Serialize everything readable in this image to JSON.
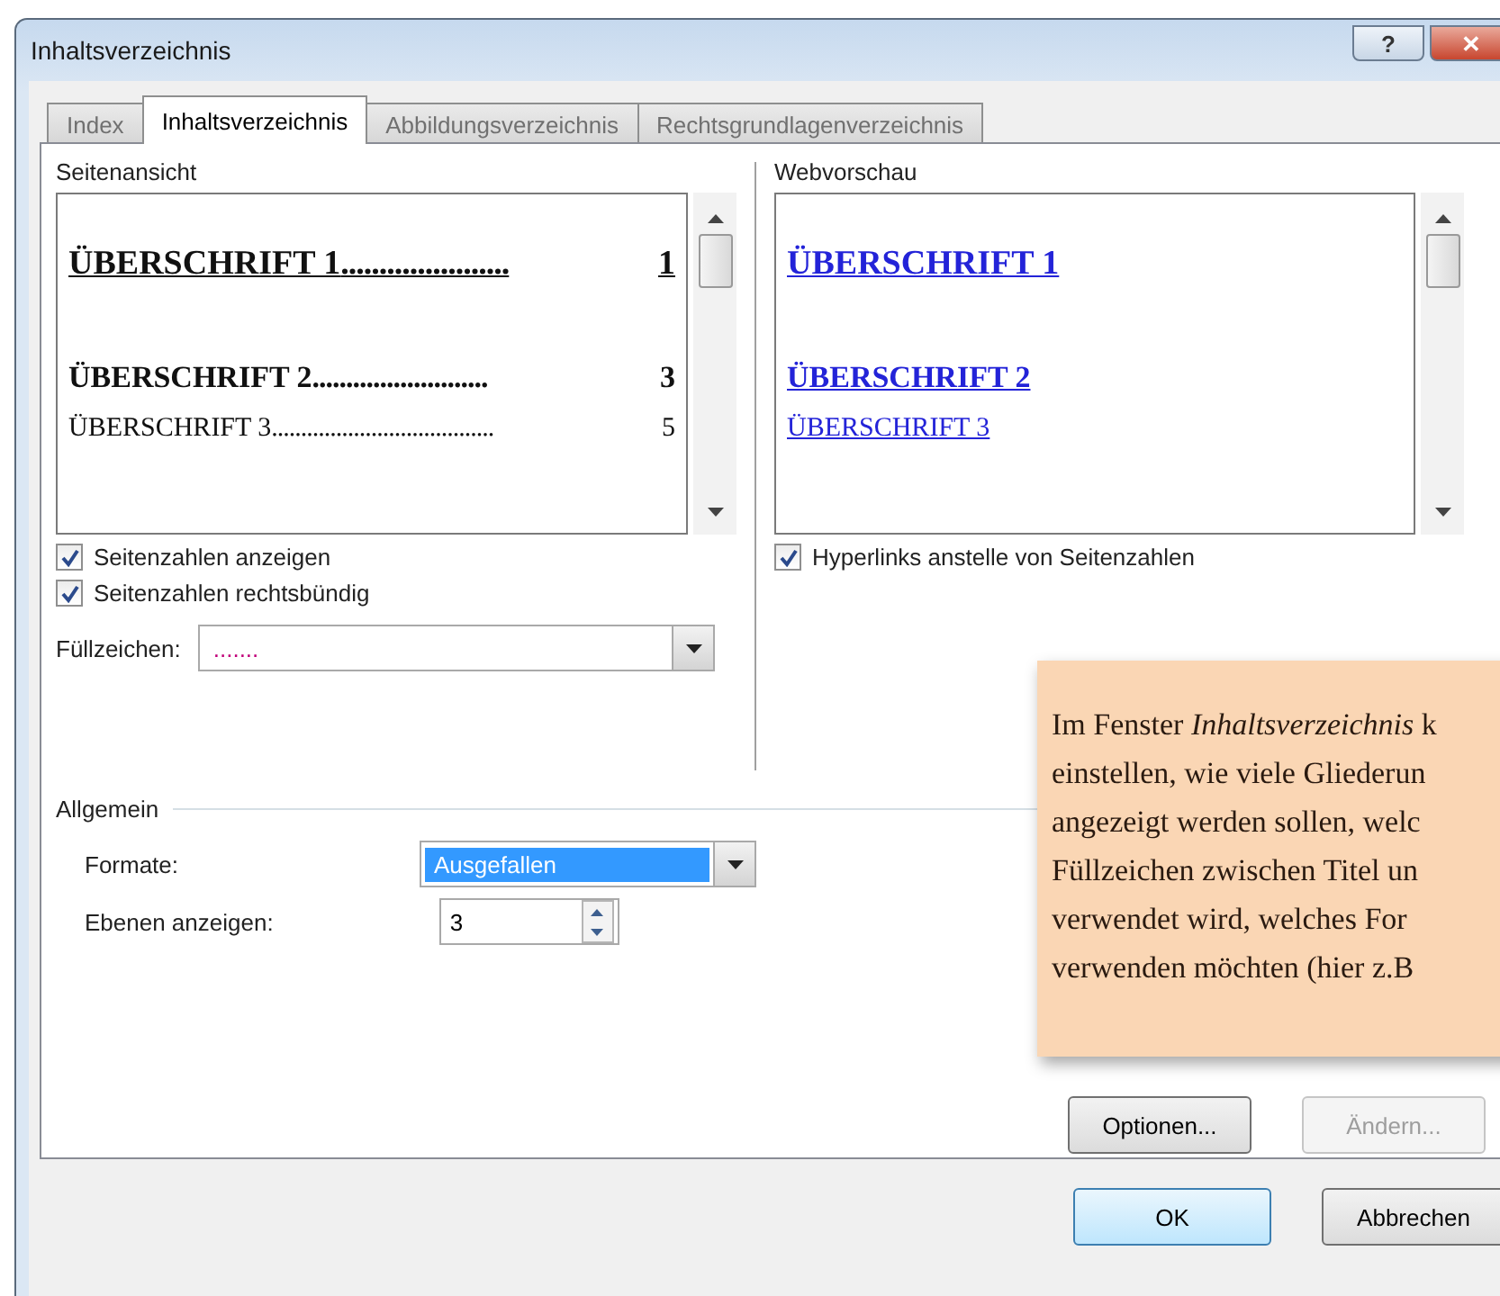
{
  "window": {
    "title": "Inhaltsverzeichnis",
    "title_buttons": [
      {
        "kind": "help",
        "label": "?"
      },
      {
        "kind": "close",
        "label": "✕"
      }
    ]
  },
  "tabs": [
    {
      "label": "Index",
      "selected": false
    },
    {
      "label": "Inhaltsverzeichnis",
      "selected": true
    },
    {
      "label": "Abbildungsverzeichnis",
      "selected": false
    },
    {
      "label": "Rechtsgrundlagenverzeichnis",
      "selected": false
    }
  ],
  "print_preview": {
    "label": "Seitenansicht",
    "entries": [
      {
        "kind": "heading1",
        "title": "ÜBERSCHRIFT 1",
        "leader": "......................",
        "page": "1"
      },
      {
        "kind": "heading2",
        "title": "ÜBERSCHRIFT 2",
        "leader": "..........................",
        "page": "3"
      },
      {
        "kind": "heading3",
        "title": "ÜBERSCHRIFT 3",
        "leader": "......................................",
        "page": "5"
      }
    ],
    "options": [
      {
        "label": "Seitenzahlen anzeigen",
        "checked": true
      },
      {
        "label": "Seitenzahlen rechtsbündig",
        "checked": true
      }
    ],
    "tab_leader": {
      "label": "Füllzeichen:",
      "value": "......."
    }
  },
  "web_preview": {
    "label": "Webvorschau",
    "entries": [
      {
        "kind": "heading1",
        "title": "ÜBERSCHRIFT 1"
      },
      {
        "kind": "heading2",
        "title": "ÜBERSCHRIFT 2"
      },
      {
        "kind": "heading3",
        "title": "ÜBERSCHRIFT 3"
      }
    ],
    "options": [
      {
        "label": "Hyperlinks anstelle von Seitenzahlen",
        "checked": true
      }
    ]
  },
  "general": {
    "label": "Allgemein",
    "formats": {
      "label": "Formate:",
      "value": "Ausgefallen",
      "highlighted": true
    },
    "levels": {
      "label": "Ebenen anzeigen:",
      "value": "3"
    }
  },
  "panel_buttons": [
    {
      "label": "Optionen...",
      "disabled": false
    },
    {
      "label": "Ändern...",
      "disabled": true
    }
  ],
  "callout": {
    "lines": [
      "Im Fenster *Inhaltsverzeichnis* k",
      "einstellen, wie viele Gliederun",
      "angezeigt werden sollen, welc",
      "Füllzeichen zwischen Titel un",
      "verwendet wird, welches For",
      "verwenden möchten (hier z.B"
    ]
  },
  "buttons": [
    {
      "label": "OK",
      "kind": "default"
    },
    {
      "label": "Abbrechen",
      "kind": "normal"
    }
  ]
}
